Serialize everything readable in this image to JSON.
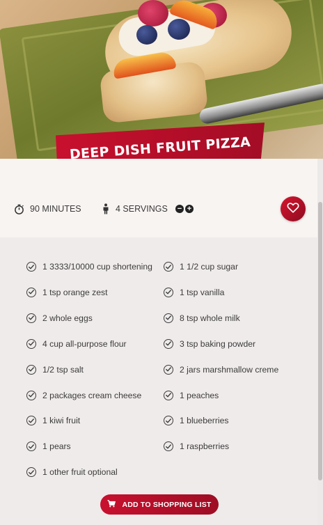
{
  "recipe": {
    "title": "DEEP DISH FRUIT PIZZA",
    "time": "90 MINUTES",
    "servings": "4 SERVINGS",
    "decrease_symbol": "−",
    "increase_symbol": "+"
  },
  "icons": {
    "time": "stopwatch-icon",
    "servings": "person-icon",
    "favorite": "heart-icon",
    "check": "check-circle-icon",
    "cart": "cart-icon"
  },
  "ingredients_left": [
    "1 3333/10000 cup shortening",
    "1 tsp orange zest",
    "2 whole eggs",
    "4 cup all-purpose flour",
    "1/2 tsp salt",
    "2 packages cream cheese",
    "1 kiwi fruit",
    "1 pears",
    "1 other fruit optional"
  ],
  "ingredients_right": [
    "1 1/2 cup sugar",
    "1 tsp vanilla",
    "8 tsp whole milk",
    "3 tsp baking powder",
    "2 jars marshmallow creme",
    "1 peaches",
    "1 blueberries",
    "1 raspberries"
  ],
  "actions": {
    "add_to_list": "ADD TO SHOPPING LIST"
  },
  "colors": {
    "accent": "#c8102e",
    "accent_dark": "#9e0d24",
    "background": "#efebea",
    "meta_background": "#f8f4f2"
  }
}
